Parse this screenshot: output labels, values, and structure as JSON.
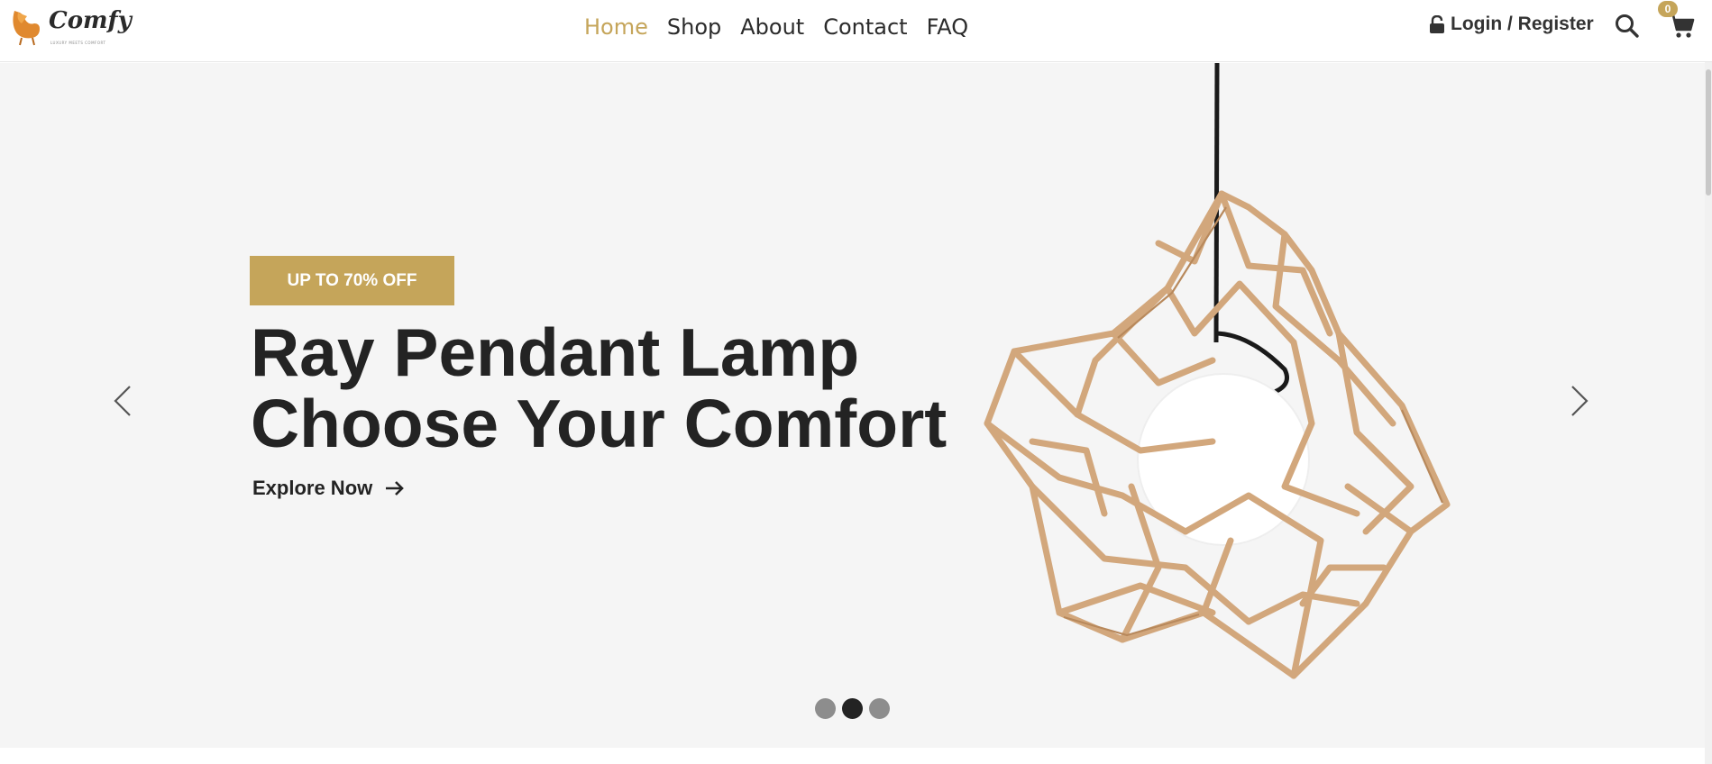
{
  "brand": {
    "name": "Comfy",
    "tagline": "LUXURY MEETS COMFORT"
  },
  "nav": {
    "items": [
      {
        "label": "Home",
        "active": true
      },
      {
        "label": "Shop",
        "active": false
      },
      {
        "label": "About",
        "active": false
      },
      {
        "label": "Contact",
        "active": false
      },
      {
        "label": "FAQ",
        "active": false
      }
    ]
  },
  "header": {
    "login_label": "Login / Register",
    "cart_count": "0"
  },
  "hero": {
    "badge": "UP TO 70% OFF",
    "headline_line1": "Ray Pendant Lamp",
    "headline_line2": "Choose Your Comfort",
    "cta_label": "Explore Now",
    "slide_count": 3,
    "active_slide": 2
  },
  "colors": {
    "accent": "#c5a55a",
    "text_dark": "#232323",
    "hero_bg": "#f5f5f5"
  },
  "icons": [
    "chair-logo-icon",
    "lock-icon",
    "search-icon",
    "cart-icon",
    "chevron-left-icon",
    "chevron-right-icon",
    "arrow-right-icon"
  ]
}
